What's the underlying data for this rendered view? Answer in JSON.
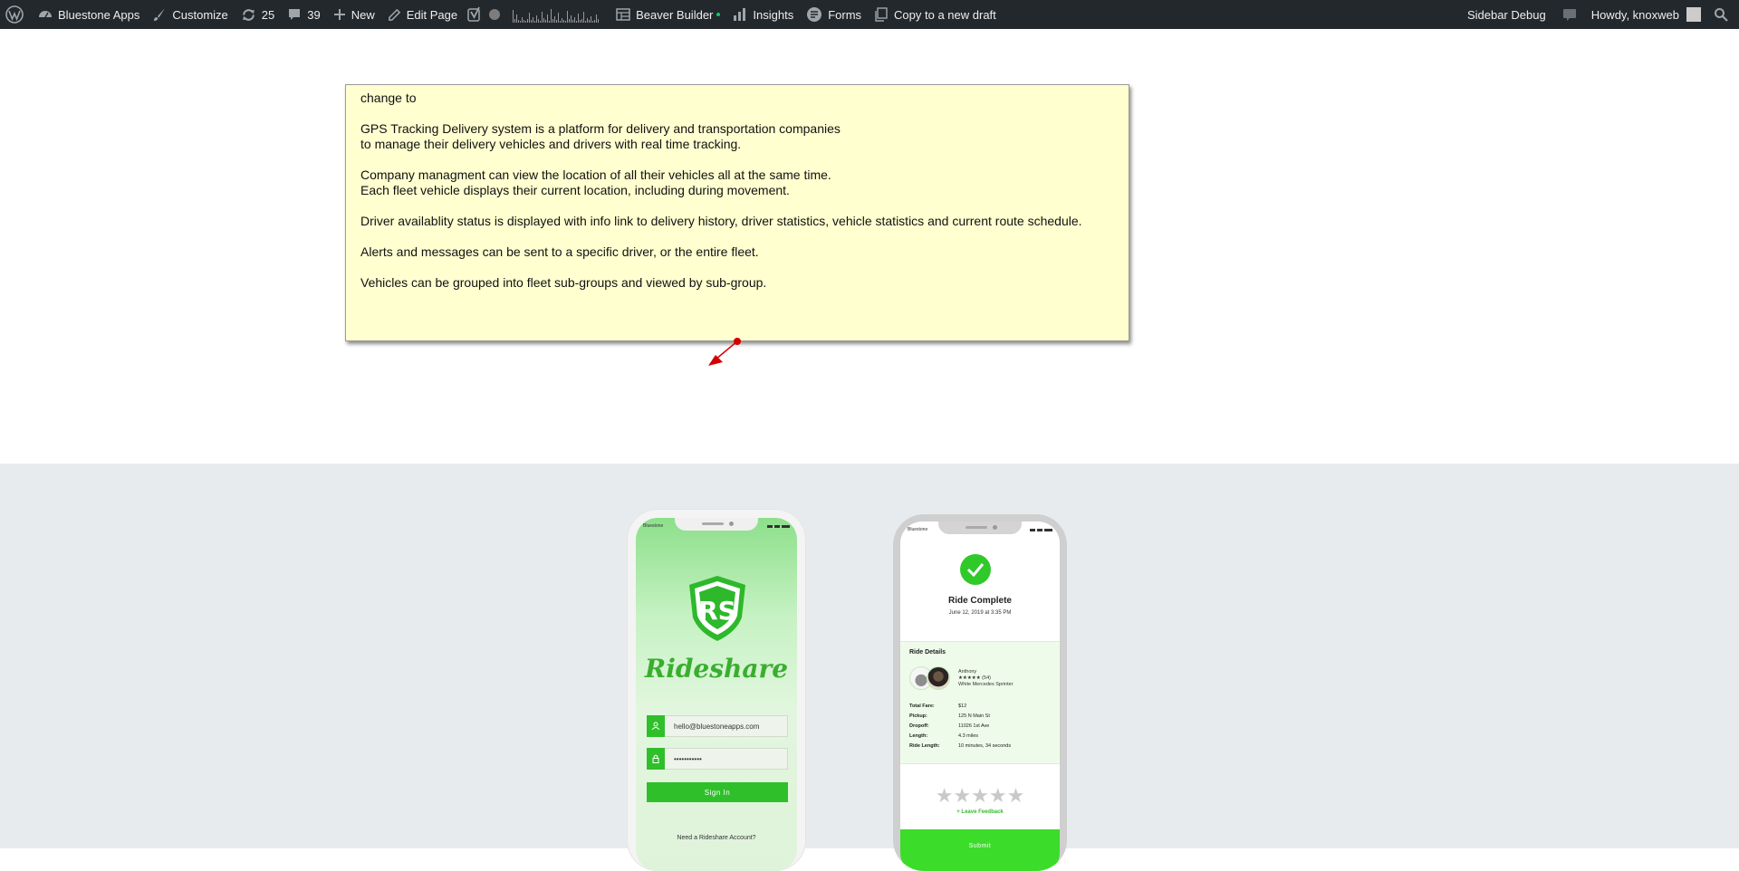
{
  "adminbar": {
    "site_name": "Bluestone Apps",
    "customize": "Customize",
    "updates_count": "25",
    "comments_count": "39",
    "new_label": "New",
    "edit_page": "Edit Page",
    "beaver_builder": "Beaver Builder",
    "insights": "Insights",
    "forms": "Forms",
    "copy_draft": "Copy to a new draft",
    "sidebar_debug": "Sidebar Debug",
    "howdy": "Howdy, knoxweb",
    "icons": [
      "wordpress-icon",
      "dashboard-icon",
      "brush-icon",
      "update-icon",
      "comment-icon",
      "plus-icon",
      "pencil-icon",
      "yoast-icon",
      "status-dot-icon",
      "sparkline-icon",
      "builder-icon",
      "insights-icon",
      "forms-icon",
      "copy-icon",
      "notification-icon",
      "avatar-icon",
      "search-icon"
    ]
  },
  "note": {
    "line1": "change to",
    "p1a": "GPS Tracking Delivery system is a platform for delivery and transportation companies",
    "p1b": "to manage their delivery vehicles and drivers with real time tracking.",
    "p2a": "Company managment can view the location of all their vehicles all at the same time.",
    "p2b": "Each fleet vehicle displays their current location, including during movement.",
    "p3": "Driver availablity status is displayed with info link to delivery history, driver statistics, vehicle statistics and current route schedule.",
    "p4": "Alerts and messages can be sent to a specific driver, or the entire fleet.",
    "p5": "Vehicles can be grouped into fleet sub-groups and viewed by sub-group."
  },
  "phone_login": {
    "carrier": "Bluestone",
    "brand": "Rideshare",
    "email": "hello@bluestoneapps.com",
    "password": "•••••••••••",
    "sign_in": "Sign In",
    "need_account": "Need a Rideshare Account?"
  },
  "phone_ride": {
    "carrier": "Bluestone",
    "title": "Ride Complete",
    "date": "June 12, 2019 at 3:35 PM",
    "details_heading": "Ride Details",
    "driver_name": "Anthony",
    "driver_rating": "★★★★★ (54)",
    "vehicle": "White Mercedes Sprinter",
    "rows": [
      {
        "label": "Total Fare:",
        "value": "$12"
      },
      {
        "label": "Pickup:",
        "value": "125 N Main St"
      },
      {
        "label": "Dropoff:",
        "value": "11026 1st Ave"
      },
      {
        "label": "Length:",
        "value": "4.3 miles"
      },
      {
        "label": "Ride Length:",
        "value": "10 minutes, 34 seconds"
      }
    ],
    "stars": "★★★★★",
    "leave_feedback": "+ Leave Feedback",
    "submit": "Submit"
  },
  "colors": {
    "adminbar": "#23282d",
    "note_bg": "#ffffd0",
    "brand_green": "#2fbf2a",
    "showcase_bg": "#e8ebee"
  }
}
